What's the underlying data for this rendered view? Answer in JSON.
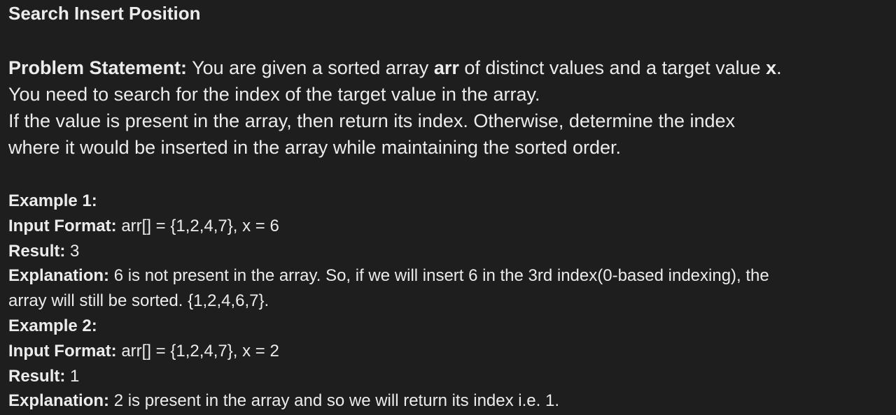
{
  "title": "Search Insert Position",
  "statement": {
    "label": "Problem Statement:",
    "line1_a": "You are given a sorted array",
    "line1_arr": "arr",
    "line1_b": "of distinct values and a target value",
    "line1_x": "x",
    "line1_end": ".",
    "line2": "You need to search for the index of the target value in the array.",
    "line3": "If the value is present in the array, then return its index. Otherwise, determine the index",
    "line4": "where it would be inserted in the array while maintaining the sorted order."
  },
  "example1": {
    "heading": "Example 1:",
    "input_label": "Input Format:",
    "input_value": "arr[] = {1,2,4,7}, x = 6",
    "result_label": "Result:",
    "result_value": "3",
    "explanation_label": "Explanation:",
    "explanation_line1": "6 is not present in the array. So, if we will insert 6 in the 3rd index(0-based indexing), the",
    "explanation_line2": "array will still be sorted. {1,2,4,6,7}."
  },
  "example2": {
    "heading": "Example 2:",
    "input_label": "Input Format:",
    "input_value": "arr[] = {1,2,4,7}, x = 2",
    "result_label": "Result:",
    "result_value": "1",
    "explanation_label": "Explanation:",
    "explanation_line1": "2 is present in the array and so we will return its index i.e. 1."
  }
}
